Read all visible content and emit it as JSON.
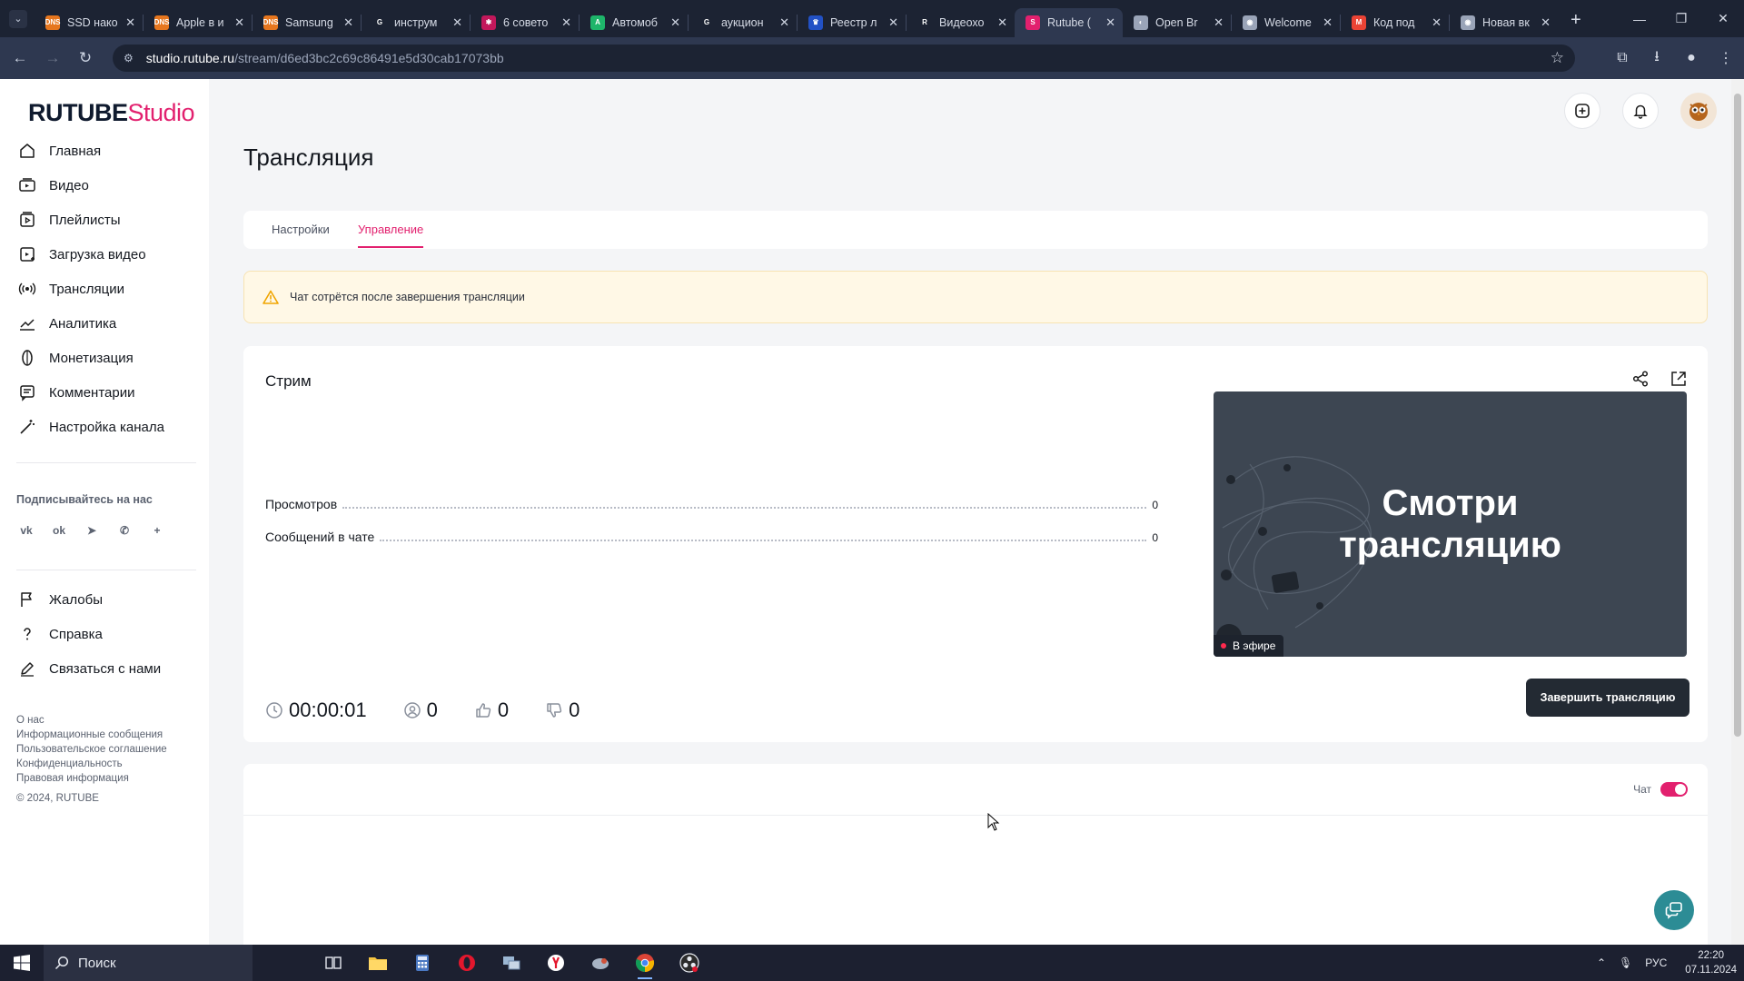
{
  "browser": {
    "tabs": [
      {
        "title": "SSD нако",
        "fav_text": "DNS",
        "fav_color": "#e6761e"
      },
      {
        "title": "Apple в и",
        "fav_text": "DNS",
        "fav_color": "#e6761e"
      },
      {
        "title": "Samsung",
        "fav_text": "DNS",
        "fav_color": "#e6761e"
      },
      {
        "title": "инструм",
        "fav_text": "G",
        "fav_color": "#ffffff"
      },
      {
        "title": "6 совето",
        "fav_text": "✱",
        "fav_color": "#c2185b"
      },
      {
        "title": "Автомоб",
        "fav_text": "A",
        "fav_color": "#1eb56a"
      },
      {
        "title": "аукцион",
        "fav_text": "G",
        "fav_color": "#ffffff"
      },
      {
        "title": "Реестр л",
        "fav_text": "♛",
        "fav_color": "#2251c5"
      },
      {
        "title": "Видеохо",
        "fav_text": "R",
        "fav_color": "#ffffff"
      },
      {
        "title": "Rutube (",
        "fav_text": "S",
        "fav_color": "#e2206e",
        "active": true
      },
      {
        "title": "Open Br",
        "fav_text": "◐",
        "fav_color": "#9aa4b8"
      },
      {
        "title": "Welcome",
        "fav_text": "◉",
        "fav_color": "#9aa4b8"
      },
      {
        "title": "Код под",
        "fav_text": "M",
        "fav_color": "#ea4335"
      },
      {
        "title": "Новая вк",
        "fav_text": "◉",
        "fav_color": "#9aa4b8"
      }
    ],
    "url_host": "studio.rutube.ru",
    "url_path": "/stream/d6ed3bc2c69c86491e5d30cab17073bb"
  },
  "logo": {
    "part1": "RUTUBE",
    "part2": "Studio"
  },
  "sidebar": {
    "nav": [
      {
        "label": "Главная",
        "icon": "home-icon"
      },
      {
        "label": "Видео",
        "icon": "video-icon"
      },
      {
        "label": "Плейлисты",
        "icon": "playlist-icon"
      },
      {
        "label": "Загрузка видео",
        "icon": "upload-icon"
      },
      {
        "label": "Трансляции",
        "icon": "broadcast-icon"
      },
      {
        "label": "Аналитика",
        "icon": "analytics-icon"
      },
      {
        "label": "Монетизация",
        "icon": "monetization-icon"
      },
      {
        "label": "Комментарии",
        "icon": "comments-icon"
      },
      {
        "label": "Настройка канала",
        "icon": "channel-settings-icon"
      }
    ],
    "subscribe_label": "Подписывайтесь на нас",
    "socials": [
      "vk-icon",
      "ok-icon",
      "telegram-icon",
      "viber-icon",
      "plus-icon"
    ],
    "nav2": [
      {
        "label": "Жалобы",
        "icon": "flag-icon"
      },
      {
        "label": "Справка",
        "icon": "help-icon"
      },
      {
        "label": "Связаться с нами",
        "icon": "edit-icon"
      }
    ],
    "footer_links": [
      "О нас",
      "Информационные сообщения",
      "Пользовательское соглашение",
      "Конфиденциальность",
      "Правовая информация"
    ],
    "copyright": "© 2024, RUTUBE"
  },
  "page": {
    "title": "Трансляция",
    "tabs": [
      "Настройки",
      "Управление"
    ],
    "active_tab": "Управление",
    "alert": "Чат сотрётся после завершения трансляции"
  },
  "stream": {
    "card_title": "Стрим",
    "stats": [
      {
        "label": "Просмотров",
        "value": "0"
      },
      {
        "label": "Сообщений в чате",
        "value": "0"
      }
    ],
    "preview_text_line1": "Смотри",
    "preview_text_line2": "трансляцию",
    "live_badge": "В эфире",
    "duration": "00:00:01",
    "viewers": "0",
    "likes": "0",
    "dislikes": "0",
    "end_button": "Завершить трансляцию"
  },
  "chat": {
    "label": "Чат",
    "enabled": true
  },
  "taskbar": {
    "search_placeholder": "Поиск",
    "lang": "РУС",
    "time": "22:20",
    "date": "07.11.2024"
  },
  "colors": {
    "accent": "#e2206e",
    "dark_button": "#232a33",
    "alert_bg": "#fff8e6",
    "help_fab": "#2c8c95"
  }
}
